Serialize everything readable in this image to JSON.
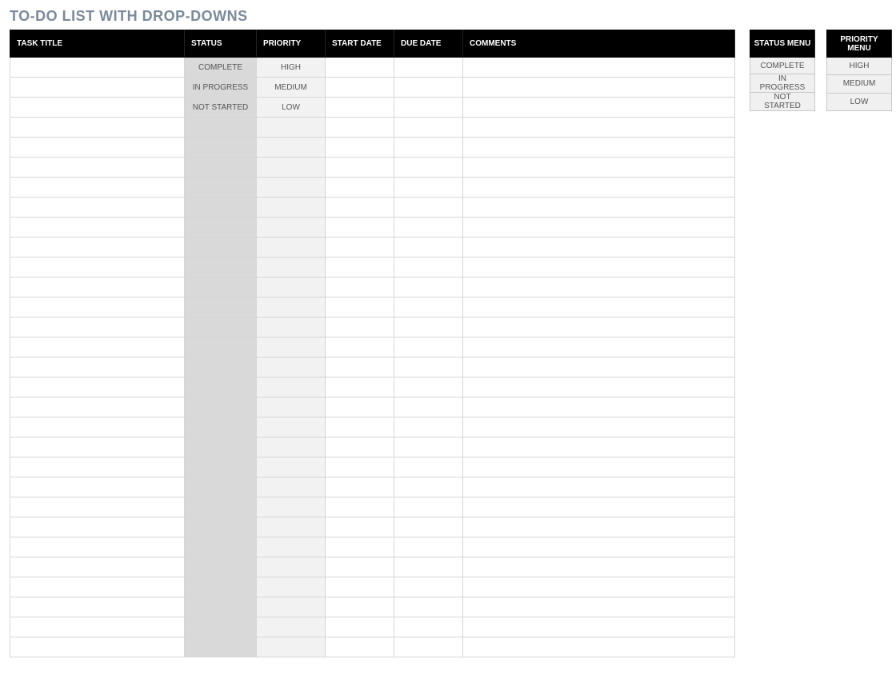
{
  "title": "TO-DO LIST WITH DROP-DOWNS",
  "main": {
    "headers": {
      "task_title": "TASK TITLE",
      "status": "STATUS",
      "priority": "PRIORITY",
      "start_date": "START DATE",
      "due_date": "DUE DATE",
      "comments": "COMMENTS"
    },
    "rows": [
      {
        "task_title": "",
        "status": "COMPLETE",
        "priority": "HIGH",
        "start_date": "",
        "due_date": "",
        "comments": ""
      },
      {
        "task_title": "",
        "status": "IN PROGRESS",
        "priority": "MEDIUM",
        "start_date": "",
        "due_date": "",
        "comments": ""
      },
      {
        "task_title": "",
        "status": "NOT STARTED",
        "priority": "LOW",
        "start_date": "",
        "due_date": "",
        "comments": ""
      },
      {
        "task_title": "",
        "status": "",
        "priority": "",
        "start_date": "",
        "due_date": "",
        "comments": ""
      },
      {
        "task_title": "",
        "status": "",
        "priority": "",
        "start_date": "",
        "due_date": "",
        "comments": ""
      },
      {
        "task_title": "",
        "status": "",
        "priority": "",
        "start_date": "",
        "due_date": "",
        "comments": ""
      },
      {
        "task_title": "",
        "status": "",
        "priority": "",
        "start_date": "",
        "due_date": "",
        "comments": ""
      },
      {
        "task_title": "",
        "status": "",
        "priority": "",
        "start_date": "",
        "due_date": "",
        "comments": ""
      },
      {
        "task_title": "",
        "status": "",
        "priority": "",
        "start_date": "",
        "due_date": "",
        "comments": ""
      },
      {
        "task_title": "",
        "status": "",
        "priority": "",
        "start_date": "",
        "due_date": "",
        "comments": ""
      },
      {
        "task_title": "",
        "status": "",
        "priority": "",
        "start_date": "",
        "due_date": "",
        "comments": ""
      },
      {
        "task_title": "",
        "status": "",
        "priority": "",
        "start_date": "",
        "due_date": "",
        "comments": ""
      },
      {
        "task_title": "",
        "status": "",
        "priority": "",
        "start_date": "",
        "due_date": "",
        "comments": ""
      },
      {
        "task_title": "",
        "status": "",
        "priority": "",
        "start_date": "",
        "due_date": "",
        "comments": ""
      },
      {
        "task_title": "",
        "status": "",
        "priority": "",
        "start_date": "",
        "due_date": "",
        "comments": ""
      },
      {
        "task_title": "",
        "status": "",
        "priority": "",
        "start_date": "",
        "due_date": "",
        "comments": ""
      },
      {
        "task_title": "",
        "status": "",
        "priority": "",
        "start_date": "",
        "due_date": "",
        "comments": ""
      },
      {
        "task_title": "",
        "status": "",
        "priority": "",
        "start_date": "",
        "due_date": "",
        "comments": ""
      },
      {
        "task_title": "",
        "status": "",
        "priority": "",
        "start_date": "",
        "due_date": "",
        "comments": ""
      },
      {
        "task_title": "",
        "status": "",
        "priority": "",
        "start_date": "",
        "due_date": "",
        "comments": ""
      },
      {
        "task_title": "",
        "status": "",
        "priority": "",
        "start_date": "",
        "due_date": "",
        "comments": ""
      },
      {
        "task_title": "",
        "status": "",
        "priority": "",
        "start_date": "",
        "due_date": "",
        "comments": ""
      },
      {
        "task_title": "",
        "status": "",
        "priority": "",
        "start_date": "",
        "due_date": "",
        "comments": ""
      },
      {
        "task_title": "",
        "status": "",
        "priority": "",
        "start_date": "",
        "due_date": "",
        "comments": ""
      },
      {
        "task_title": "",
        "status": "",
        "priority": "",
        "start_date": "",
        "due_date": "",
        "comments": ""
      },
      {
        "task_title": "",
        "status": "",
        "priority": "",
        "start_date": "",
        "due_date": "",
        "comments": ""
      },
      {
        "task_title": "",
        "status": "",
        "priority": "",
        "start_date": "",
        "due_date": "",
        "comments": ""
      },
      {
        "task_title": "",
        "status": "",
        "priority": "",
        "start_date": "",
        "due_date": "",
        "comments": ""
      },
      {
        "task_title": "",
        "status": "",
        "priority": "",
        "start_date": "",
        "due_date": "",
        "comments": ""
      },
      {
        "task_title": "",
        "status": "",
        "priority": "",
        "start_date": "",
        "due_date": "",
        "comments": ""
      }
    ]
  },
  "status_menu": {
    "header": "STATUS MENU",
    "items": [
      "COMPLETE",
      "IN PROGRESS",
      "NOT STARTED"
    ]
  },
  "priority_menu": {
    "header": "PRIORITY MENU",
    "items": [
      "HIGH",
      "MEDIUM",
      "LOW"
    ]
  }
}
